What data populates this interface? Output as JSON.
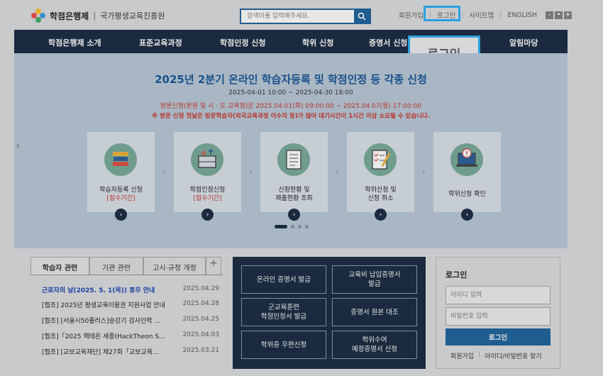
{
  "header": {
    "logo_text": "학점은행제",
    "logo_sep": "|",
    "logo_sub": "국가평생교육진흥원",
    "search_placeholder": "검색어를 입력해주세요.",
    "util_links": [
      "회원가입",
      "로그인",
      "사이트맵",
      "ENGLISH"
    ],
    "zoom": [
      "-",
      "•",
      "+"
    ]
  },
  "nav": {
    "items": [
      "학점은행제 소개",
      "표준교육과정",
      "학점인정 신청",
      "학위 신청",
      "증명서 신청",
      "알림마당"
    ]
  },
  "callout": {
    "label": "로그인"
  },
  "hero": {
    "title": "2025년 2분기 온라인 학습자등록 및 학점인정 등 각종 신청",
    "date": "2025-04-01 10:00 ~ 2025-04-30 18:00",
    "visit": "방문신청(본원 및 시 · 도 교육청)은 2025.04.01(화) 09:00:00 ~ 2025.04.07(월) 17:00:00",
    "notice": "※ 방문 신청 첫날은 방문학습자(외국교육과정 이수자 등)가 많아 대기시간이 1시간 이상 소요될 수 있습니다.",
    "cards": [
      {
        "line1": "학습자등록 신청",
        "line2": "[접수기간]"
      },
      {
        "line1": "학점인정신청",
        "line2": "[접수기간]"
      },
      {
        "line1": "신청현황 및",
        "line2": "제출현황 조회"
      },
      {
        "line1": "학위신청 및",
        "line2": "신청 취소"
      },
      {
        "line1": "학위신청 확인",
        "line2": ""
      }
    ]
  },
  "news": {
    "tabs": [
      "학습자 관련",
      "기관 관련",
      "고시·규정 개정"
    ],
    "plus": "+",
    "rows": [
      {
        "title": "근로자의 날(2025. 5. 1(목)) 휴무 안내",
        "date": "2025.04.29"
      },
      {
        "title": "[협조] 2025년 평생교육이용권 지원사업 안내",
        "date": "2025.04.28"
      },
      {
        "title": "[협조] [서울시50플러스]승강기 검사인력 ...",
        "date": "2025.04.25"
      },
      {
        "title": "[협조]「2025 핵테온 세종(HackTheon S...",
        "date": "2025.04.03"
      },
      {
        "title": "[협조] [교보교육재단] 제27회「교보교육...",
        "date": "2025.03.21"
      }
    ]
  },
  "services": [
    "온라인 증명서 발급",
    "교육비 납입증명서\n발급",
    "군교육훈련\n학점인정서 발급",
    "증명서 원본 대조",
    "학위증 우편신청",
    "학위수여\n예정증명서 신청"
  ],
  "login": {
    "title": "로그인",
    "id_placeholder": "아이디 입력",
    "pw_placeholder": "비밀번호 입력",
    "button": "로그인",
    "join": "회원가입",
    "sep": "|",
    "find": "아이디/비밀번호 찾기"
  },
  "colors": {
    "nav_bg": "#1b2a3e",
    "accent": "#1f5c8f",
    "highlight": "#2aa0e0",
    "hero_title": "#1b4f8a",
    "alert": "#b8312a"
  }
}
